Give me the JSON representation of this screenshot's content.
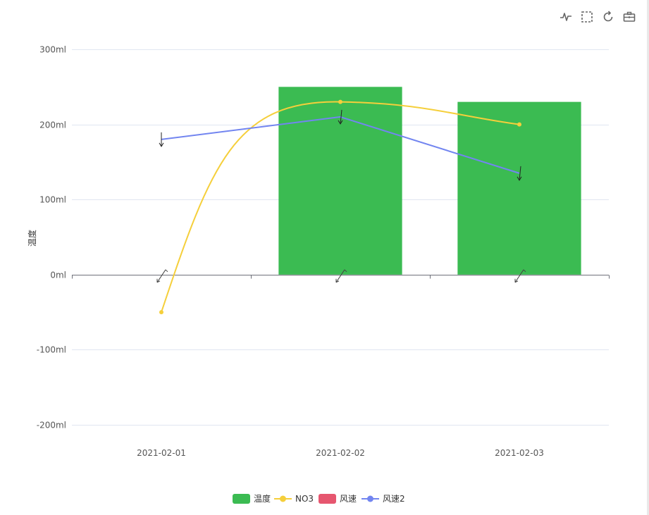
{
  "toolbox": [
    {
      "name": "line-chart-icon",
      "icon": "line-chart"
    },
    {
      "name": "box-select-icon",
      "icon": "box-select"
    },
    {
      "name": "restore-icon",
      "icon": "restore"
    },
    {
      "name": "toolbox-briefcase-icon",
      "icon": "briefcase"
    }
  ],
  "chart_data": {
    "type": "bar",
    "categories": [
      "2021-02-01",
      "2021-02-02",
      "2021-02-03"
    ],
    "ylabel": "温度",
    "y_unit": "ml",
    "ylim": [
      -200,
      300
    ],
    "y_ticks": [
      300,
      200,
      100,
      0,
      -100,
      -200
    ],
    "y_tick_labels": [
      "300ml",
      "200ml",
      "100ml",
      "0ml",
      "-100ml",
      "-200ml"
    ],
    "grid": true,
    "legend_position": "bottom-center",
    "series": [
      {
        "name": "温度",
        "kind": "bar",
        "color": "#3bbb52",
        "values": [
          null,
          250,
          230
        ]
      },
      {
        "name": "NO3",
        "kind": "line",
        "smooth": true,
        "color": "#f5cf3b",
        "values": [
          -50,
          230,
          200
        ]
      },
      {
        "name": "风速",
        "kind": "windbarb",
        "color": "#e6566f",
        "values": [
          0,
          0,
          0
        ]
      },
      {
        "name": "风速2",
        "kind": "line",
        "color": "#7285f0",
        "values": [
          180,
          210,
          135
        ]
      }
    ]
  }
}
